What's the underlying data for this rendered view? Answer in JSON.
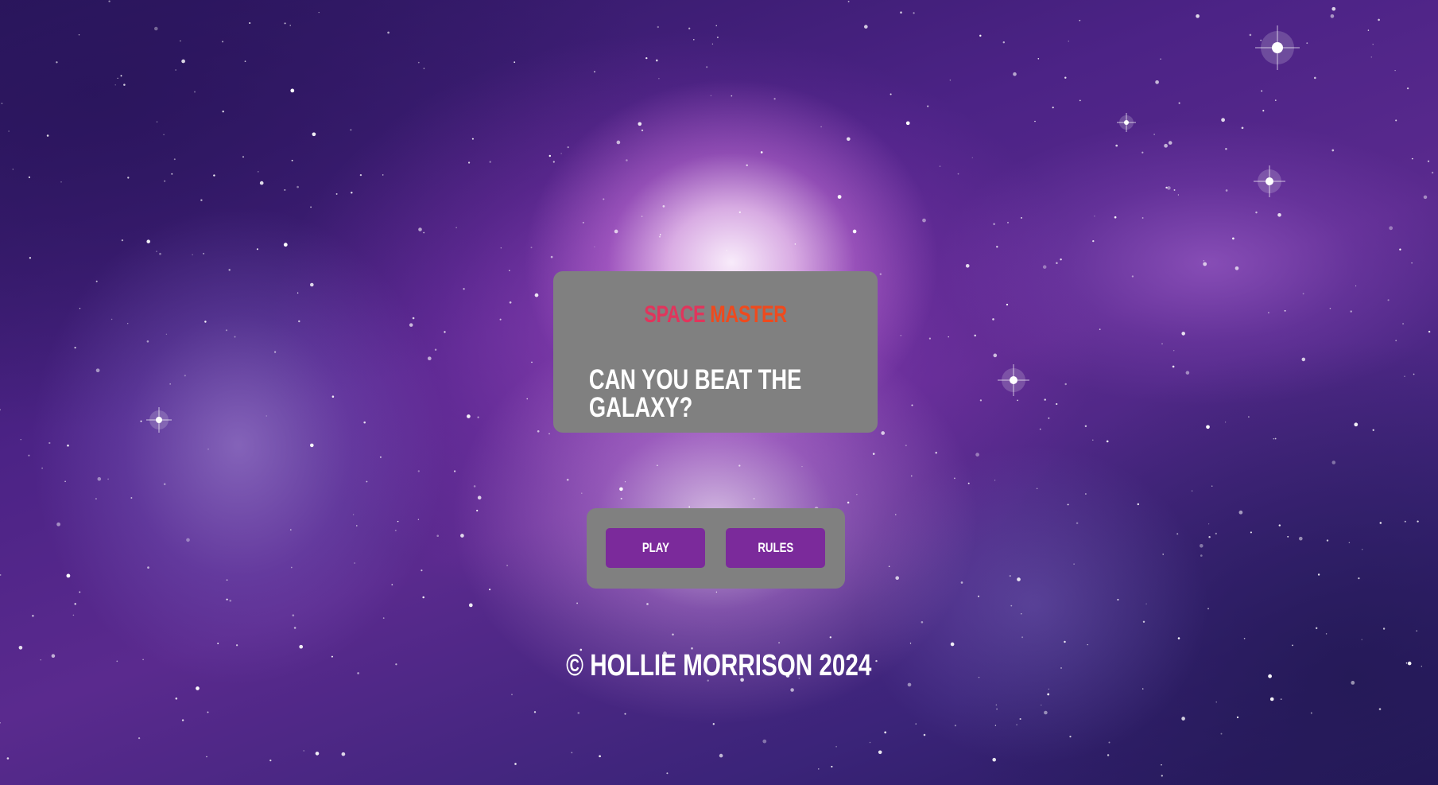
{
  "title_card": {
    "title_part1": "SPACE",
    "title_part2": "MASTER",
    "tagline": "CAN YOU BEAT THE GALAXY?"
  },
  "menu": {
    "play_label": "PLAY",
    "rules_label": "RULES"
  },
  "footer": {
    "copyright": "© HOLLIE MORRISON 2024"
  },
  "colors": {
    "title_space": "#e0355c",
    "title_master": "#ee4a1e",
    "card_bg": "#808080",
    "button_bg": "#7b2a9b",
    "text": "#ffffff"
  }
}
